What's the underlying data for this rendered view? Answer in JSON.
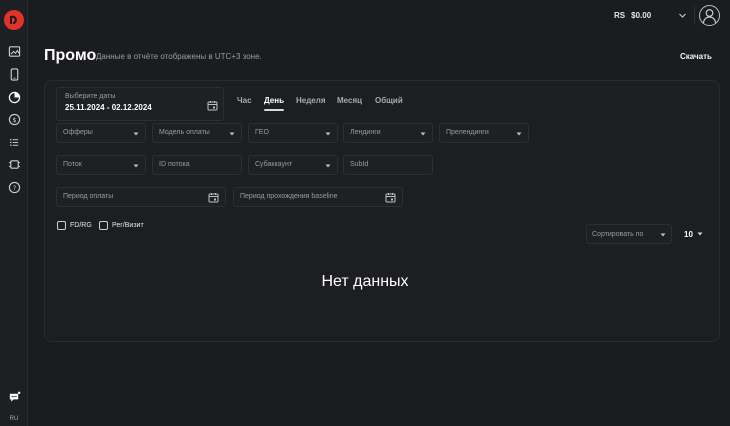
{
  "header": {
    "currency": "RS",
    "balance": "$0.00"
  },
  "page": {
    "title": "Промо",
    "subtitle": "Данные в отчёте отображены в UTC+3 зоне.",
    "download_label": "Скачать"
  },
  "date_picker": {
    "label": "Выберите даты",
    "value": "25.11.2024 - 02.12.2024"
  },
  "tabs": [
    {
      "label": "Час",
      "active": false
    },
    {
      "label": "День",
      "active": true
    },
    {
      "label": "Неделя",
      "active": false
    },
    {
      "label": "Месяц",
      "active": false
    },
    {
      "label": "Общий",
      "active": false
    }
  ],
  "filters": {
    "offers": "Офферы",
    "payment_model": "Модель оплаты",
    "geo": "ГЕО",
    "landings": "Лендинги",
    "prelandings": "Прелендинги",
    "stream": "Поток",
    "stream_id": "ID потока",
    "subaccount": "Субаккаунт",
    "subid": "SubId",
    "payment_period": "Период оплаты",
    "baseline_period": "Период прохождения baseline"
  },
  "checkboxes": {
    "fd_rg": "FD/RG",
    "reg_visit": "Рег/Визит"
  },
  "sort": {
    "label": "Сортировать по",
    "per_page": "10"
  },
  "empty_state": "Нет данных",
  "sidebar": {
    "lang": "RU"
  }
}
